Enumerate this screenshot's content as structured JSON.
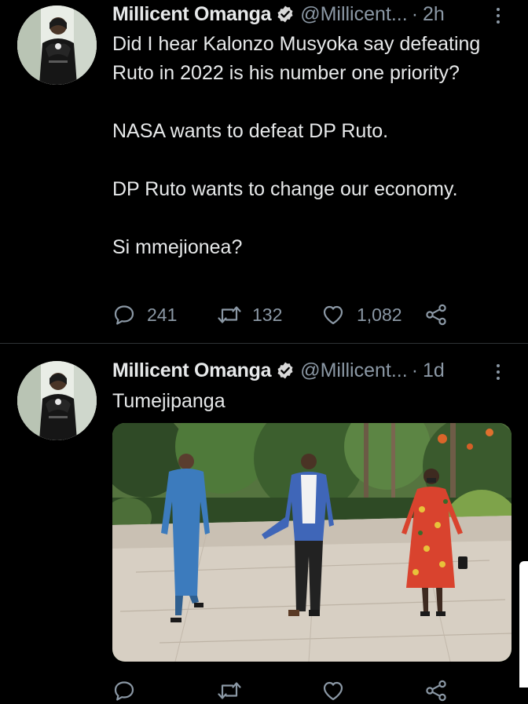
{
  "colors": {
    "background": "#000000",
    "text": "#e7e9ea",
    "muted": "#8b98a5",
    "verified_badge": "#d9d9d9",
    "separator": "#2f3336"
  },
  "tweets": [
    {
      "display_name": "Millicent Omanga",
      "handle": "@Millicent...",
      "separator": "·",
      "time": "2h",
      "avatar_icon": "avatar-photo",
      "verified_icon": "verified-badge-icon",
      "more_icon": "more-vertical-icon",
      "paragraphs": [
        "Did I hear Kalonzo Musyoka say defeating Ruto in 2022 is his number one priority?",
        "NASA wants to defeat DP Ruto.",
        "DP Ruto wants to change our economy.",
        "Si mmejionea?"
      ],
      "actions": {
        "reply_count": "241",
        "retweet_count": "132",
        "like_count": "1,082"
      }
    },
    {
      "display_name": "Millicent Omanga",
      "handle": "@Millicent...",
      "separator": "·",
      "time": "1d",
      "avatar_icon": "avatar-photo",
      "verified_icon": "verified-badge-icon",
      "more_icon": "more-vertical-icon",
      "paragraphs": [
        "Tumejipanga"
      ],
      "media_icon": "tweet-photo",
      "actions": {
        "reply_count": "",
        "retweet_count": "",
        "like_count": ""
      }
    }
  ]
}
